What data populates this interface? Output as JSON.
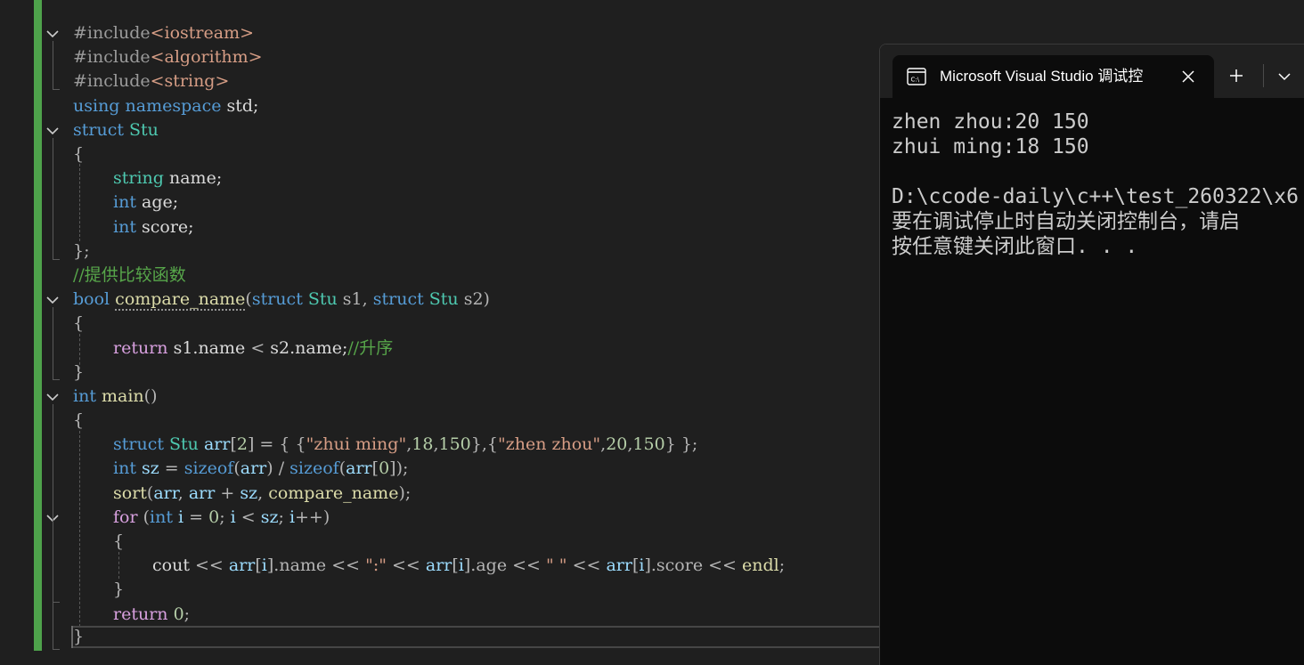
{
  "editor": {
    "lines": {
      "l1": {
        "a": "#include",
        "b": "<iostream>"
      },
      "l2": {
        "a": "#include",
        "b": "<algorithm>"
      },
      "l3": {
        "a": "#include",
        "b": "<string>"
      },
      "l4": {
        "a": "using",
        "b": " ",
        "c": "namespace",
        "d": " std;"
      },
      "l5": {
        "a": "struct",
        "b": " ",
        "c": "Stu"
      },
      "l6": {
        "a": "{"
      },
      "l7": {
        "a": "string",
        "b": " name;"
      },
      "l8": {
        "a": "int",
        "b": " age;"
      },
      "l9": {
        "a": "int",
        "b": " score;"
      },
      "l10": {
        "a": "};"
      },
      "l11": {
        "a": "//提供比较函数"
      },
      "l12": {
        "a": "bool",
        "b": " ",
        "c": "compare_name",
        "d": "(",
        "e": "struct",
        "f": " ",
        "g": "Stu",
        "h": " s1, ",
        "i": "struct",
        "j": " ",
        "k": "Stu",
        "l": " s2)"
      },
      "l13": {
        "a": "{"
      },
      "l14": {
        "a": "return",
        "b": " s1.name ",
        "c": "<",
        "d": " s2.name;",
        "e": "//升序"
      },
      "l15": {
        "a": "}"
      },
      "l16": {
        "a": "int",
        "b": " ",
        "c": "main",
        "d": "()"
      },
      "l17": {
        "a": "{"
      },
      "l18": {
        "a": "struct",
        "b": " ",
        "c": "Stu",
        "d": " ",
        "e": "arr",
        "f": "[",
        "g": "2",
        "h": "] = { {",
        "i": "\"zhui ming\"",
        "j": ",",
        "k": "18",
        "l": ",",
        "m": "150",
        "n": "},{",
        "o": "\"zhen zhou\"",
        "p": ",",
        "q": "20",
        "r": ",",
        "s": "150",
        "t": "} };"
      },
      "l19": {
        "a": "int",
        "b": " ",
        "c": "sz",
        "d": " = ",
        "e": "sizeof",
        "f": "(",
        "g": "arr",
        "h": ") / ",
        "i": "sizeof",
        "j": "(",
        "k": "arr",
        "l": "[",
        "m": "0",
        "n": "]);"
      },
      "l20": {
        "a": "sort",
        "b": "(",
        "c": "arr",
        "d": ", ",
        "e": "arr",
        "f": " + ",
        "g": "sz",
        "h": ", ",
        "i": "compare_name",
        "j": ");"
      },
      "l21": {
        "a": "for",
        "b": " (",
        "c": "int",
        "d": " ",
        "e": "i",
        "f": " = ",
        "g": "0",
        "h": "; ",
        "i": "i",
        "j": " < ",
        "k": "sz",
        "l": "; ",
        "m": "i",
        "n": "++)"
      },
      "l22": {
        "a": "{"
      },
      "l23": {
        "a": "cout",
        "b": " << ",
        "c": "arr",
        "d": "[",
        "e": "i",
        "f": "].name << ",
        "g": "\":\"",
        "h": " << ",
        "i": "arr",
        "j": "[",
        "k": "i",
        "l": "].age << ",
        "m": "\" \"",
        "n": " << ",
        "o": "arr",
        "p": "[",
        "q": "i",
        "r": "].score << ",
        "s": "endl",
        "t": ";"
      },
      "l24": {
        "a": "}"
      },
      "l25": {
        "a": "return",
        "b": " ",
        "c": "0",
        "d": ";"
      },
      "l26": {
        "a": "}"
      }
    }
  },
  "console": {
    "tab_title": "Microsoft Visual Studio 调试控",
    "icon": "console-app-icon",
    "output": [
      "zhen zhou:20 150",
      "zhui ming:18 150",
      "",
      "D:\\ccode-daily\\c++\\test_260322\\x6",
      "要在调试停止时自动关闭控制台，请启",
      "按任意键关闭此窗口. . ."
    ]
  },
  "colors": {
    "editor_bg": "#1f1f1f",
    "keyword": "#569cd6",
    "control": "#d8a0df",
    "type": "#4ec9b0",
    "function": "#dcdcaa",
    "variable": "#9cdcfe",
    "string": "#d69d85",
    "number": "#b5cea8",
    "comment": "#57a64a",
    "change_bar": "#4ea24b",
    "console_bg": "#0c0c0c"
  }
}
